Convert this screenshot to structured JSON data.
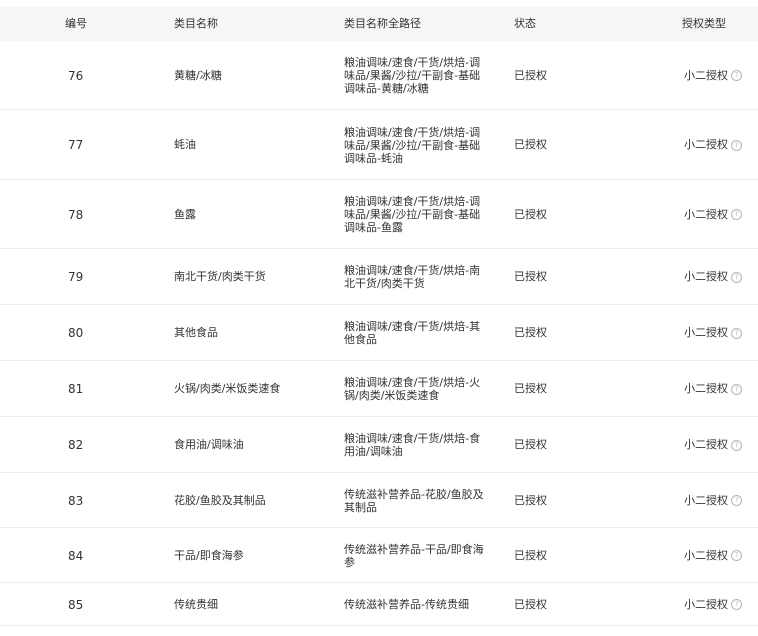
{
  "table": {
    "columns": {
      "id": "编号",
      "name": "类目名称",
      "path": "类目名称全路径",
      "status": "状态",
      "auth_type": "授权类型"
    },
    "rows": [
      {
        "id": "76",
        "name": "黄糖/冰糖",
        "path": "粮油调味/速食/干货/烘焙-调\n味品/果酱/沙拉/干副食-基础\n调味品-黄糖/冰糖",
        "status": "已授权",
        "auth_type": "小二授权"
      },
      {
        "id": "77",
        "name": "蚝油",
        "path": "粮油调味/速食/干货/烘焙-调\n味品/果酱/沙拉/干副食-基础\n调味品-蚝油",
        "status": "已授权",
        "auth_type": "小二授权"
      },
      {
        "id": "78",
        "name": "鱼露",
        "path": "粮油调味/速食/干货/烘焙-调\n味品/果酱/沙拉/干副食-基础\n调味品-鱼露",
        "status": "已授权",
        "auth_type": "小二授权"
      },
      {
        "id": "79",
        "name": "南北干货/肉类干货",
        "path": "粮油调味/速食/干货/烘焙-南\n北干货/肉类干货",
        "status": "已授权",
        "auth_type": "小二授权"
      },
      {
        "id": "80",
        "name": "其他食品",
        "path": "粮油调味/速食/干货/烘焙-其\n他食品",
        "status": "已授权",
        "auth_type": "小二授权"
      },
      {
        "id": "81",
        "name": "火锅/肉类/米饭类速食",
        "path": "粮油调味/速食/干货/烘焙-火\n锅/肉类/米饭类速食",
        "status": "已授权",
        "auth_type": "小二授权"
      },
      {
        "id": "82",
        "name": "食用油/调味油",
        "path": "粮油调味/速食/干货/烘焙-食\n用油/调味油",
        "status": "已授权",
        "auth_type": "小二授权"
      },
      {
        "id": "83",
        "name": "花胶/鱼胶及其制品",
        "path": "传统滋补营养品-花胶/鱼胶及\n其制品",
        "status": "已授权",
        "auth_type": "小二授权"
      },
      {
        "id": "84",
        "name": "干品/即食海参",
        "path": "传统滋补营养品-干品/即食海\n参",
        "status": "已授权",
        "auth_type": "小二授权"
      },
      {
        "id": "85",
        "name": "传统贵细",
        "path": "传统滋补营养品-传统贵细",
        "status": "已授权",
        "auth_type": "小二授权"
      }
    ]
  },
  "icons": {
    "help": "question-circle-icon",
    "help_glyph": "?"
  }
}
